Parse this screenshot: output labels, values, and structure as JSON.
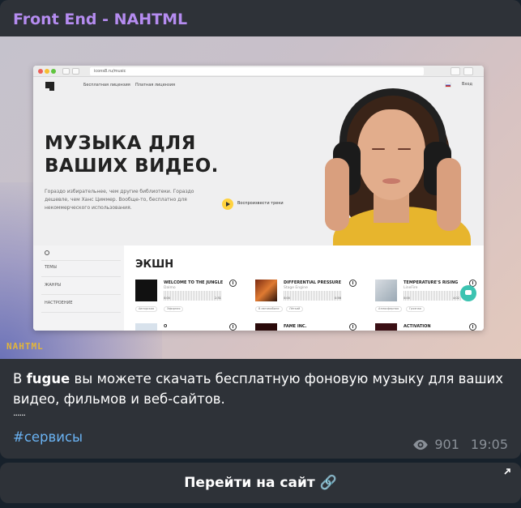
{
  "channel": {
    "name": "Front End - NAHTML"
  },
  "media": {
    "watermark": "NAHTML",
    "browser": {
      "url": "icons8.ru/music",
      "nav": [
        "Бесплатная лицензия",
        "Платная лицензия"
      ],
      "login": "Вход",
      "hero_title": "МУЗЫКА ДЛЯ ВАШИХ ВИДЕО.",
      "hero_subtitle": "Гораздо избирательнее, чем другие библиотеки. Гораздо дешевле, чем Ханс Циммер. Вообще-то, бесплатно для некоммерческого использования.",
      "play_label": "Воспроизвести треки",
      "sidebar": [
        "ТЕМЫ",
        "ЖАНРЫ",
        "НАСТРОЕНИЕ"
      ],
      "genre": "ЭКШН",
      "tracks": [
        {
          "title": "WELCOME TO THE JUNGLE",
          "artist": "Dalmo",
          "t0": "0:00",
          "t1": "2:31",
          "tags": [
            "Авторская",
            "Эфирная"
          ]
        },
        {
          "title": "DIFFERENTIAL PRESSURE",
          "artist": "Stage Engine",
          "t0": "0:00",
          "t1": "0:56",
          "tags": [
            "В автомобиле",
            "Лёгкий"
          ]
        },
        {
          "title": "TEMPERATURE'S RISING",
          "artist": "LineFire",
          "t0": "0:00",
          "t1": "4:02",
          "tags": [
            "Атмосферная",
            "Грязная"
          ]
        },
        {
          "title": "O",
          "artist": "",
          "t0": "",
          "t1": "",
          "tags": []
        },
        {
          "title": "FAME INC.",
          "artist": "",
          "t0": "",
          "t1": "",
          "tags": []
        },
        {
          "title": "ACTIVATION",
          "artist": "",
          "t0": "",
          "t1": "",
          "tags": []
        }
      ]
    }
  },
  "post": {
    "caption_prefix": "В ",
    "caption_bold": "fugue",
    "caption_rest": " вы можете скачать бесплатную фоновую музыку для ваших видео, фильмов и веб-сайтов.",
    "separator": "......",
    "hashtag": "#сервисы",
    "views": "901",
    "time": "19:05"
  },
  "button": {
    "label": "Перейти на сайт 🔗"
  },
  "colors": {
    "channel": "#b58cf0",
    "hashtag": "#6ab3f3",
    "bubble": "#2e3238",
    "bg": "#17212b"
  }
}
